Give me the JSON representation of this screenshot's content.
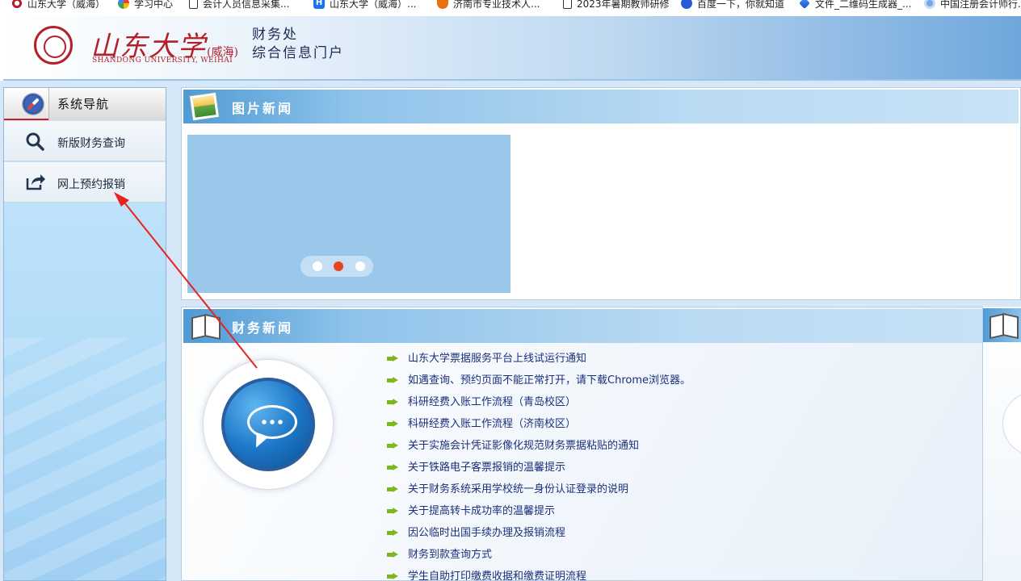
{
  "bookmarks": [
    {
      "label": "山东大学（威海）",
      "icon": "sdu-logo-icon"
    },
    {
      "label": "学习中心",
      "icon": "star-icon"
    },
    {
      "label": "会计人员信息采集...",
      "icon": "page-icon"
    },
    {
      "label": "山东大学（威海）...",
      "icon": "h-icon"
    },
    {
      "label": "济南市专业技术人...",
      "icon": "shield-icon"
    },
    {
      "label": "2023年暑期教师研修",
      "icon": "page-icon"
    },
    {
      "label": "百度一下，你就知道",
      "icon": "baidu-paw-icon"
    },
    {
      "label": "文件_二维码生成器_...",
      "icon": "diamond-icon"
    },
    {
      "label": "中国注册会计师行...",
      "icon": "flower-icon"
    }
  ],
  "header": {
    "logo_cn": "山东大学",
    "logo_branch": "(威海)",
    "logo_en": "SHANDONG UNIVERSITY, WEIHAI",
    "dept_line1": "财务处",
    "dept_line2": "综合信息门户"
  },
  "sidebar": {
    "title": "系统导航",
    "items": [
      {
        "label": "新版财务查询",
        "icon": "search-icon"
      },
      {
        "label": "网上预约报销",
        "icon": "share-icon"
      }
    ]
  },
  "picture_news": {
    "title": "图片新闻",
    "carousel": {
      "slides": 3,
      "active_slide": 2
    }
  },
  "finance_news": {
    "title": "财务新闻",
    "items": [
      "山东大学票据服务平台上线试运行通知",
      "如遇查询、预约页面不能正常打开，请下载Chrome浏览器。",
      "科研经费入账工作流程（青岛校区）",
      "科研经费入账工作流程（济南校区）",
      "关于实施会计凭证影像化规范财务票据粘贴的通知",
      "关于铁路电子客票报销的温馨提示",
      "关于财务系统采用学校统一身份认证登录的说明",
      "关于提高转卡成功率的温馨提示",
      "因公临时出国手续办理及报销流程",
      "财务到款查询方式",
      "学生自助打印缴费收据和缴费证明流程"
    ]
  },
  "colors": {
    "brand_red": "#b3202a",
    "news_link": "#1b2f7a",
    "arrow_green": "#7cb71e",
    "annotation_arrow": "#e8231f",
    "active_dot": "#e8441b"
  }
}
